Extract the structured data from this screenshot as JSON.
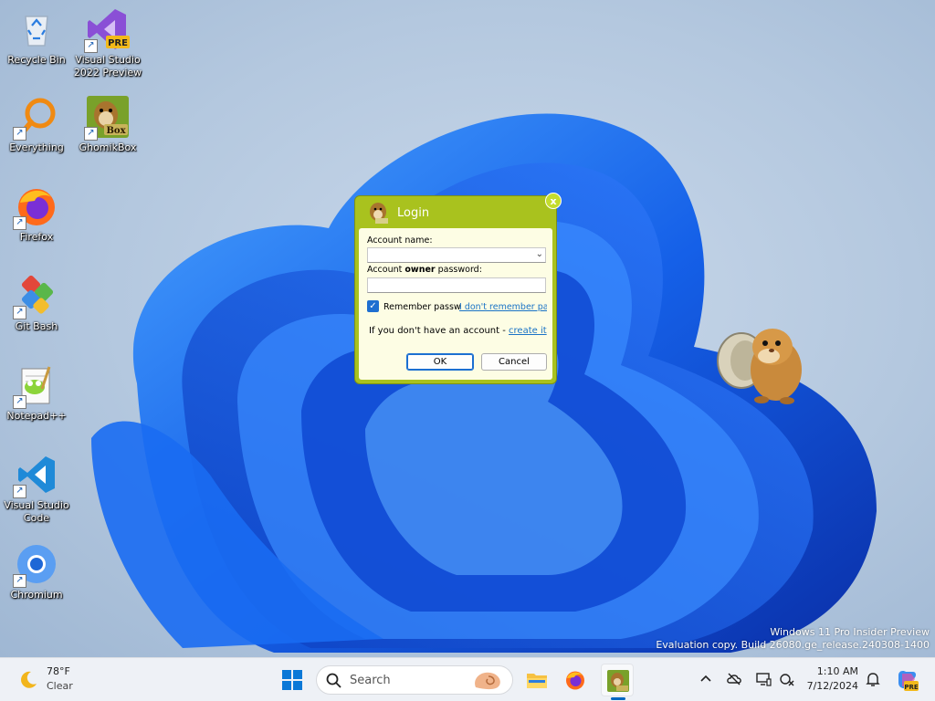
{
  "desktop": {
    "icons": [
      {
        "label": "Recycle Bin"
      },
      {
        "label": "Visual Studio 2022 Preview",
        "badge": "PRE"
      },
      {
        "label": "Everything"
      },
      {
        "label": "GhomikBox",
        "badge": "Box"
      },
      {
        "label": "Firefox"
      },
      {
        "label": "Git Bash"
      },
      {
        "label": "Notepad++"
      },
      {
        "label": "Visual Studio Code"
      },
      {
        "label": "Chromium"
      }
    ],
    "watermark": {
      "line1": "Windows 11 Pro Insider Preview",
      "line2": "Evaluation copy. Build 26080.ge_release.240308-1400"
    }
  },
  "dialog": {
    "title": "Login",
    "close_glyph": "x",
    "account_label": "Account name:",
    "account_value": "",
    "password_label_prefix": "Account ",
    "password_label_bold": "owner",
    "password_label_suffix": " password:",
    "password_value": "",
    "remember_checked": true,
    "remember_label": "Remember passw",
    "forgot_link": "I don't remember pas",
    "no_account_text": "If you don't have an account - ",
    "create_link": "create it",
    "ok_label": "OK",
    "cancel_label": "Cancel",
    "accent_color": "#a9c21e"
  },
  "taskbar": {
    "weather_temp": "78°F",
    "weather_condition": "Clear",
    "search_placeholder": "Search",
    "apps": [
      "file-explorer",
      "firefox",
      "ghomikbox"
    ],
    "tray_icons": [
      "chevron-up-icon",
      "onedrive-icon",
      "display-icon",
      "network-icon"
    ],
    "clock_time": "1:10 AM",
    "clock_date": "7/12/2024",
    "copilot_badge": "PRE"
  }
}
